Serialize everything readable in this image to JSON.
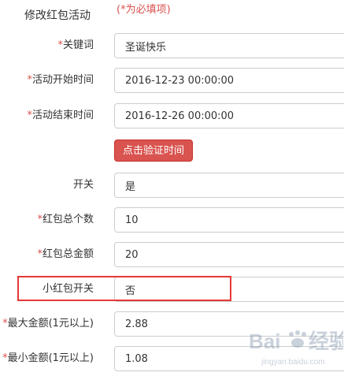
{
  "header": {
    "title": "修改红包活动",
    "required_note": "(*为必填项)"
  },
  "form": {
    "fields": [
      {
        "marker": "*",
        "label": "关键词",
        "value": "圣诞快乐"
      },
      {
        "marker": "*",
        "label": "活动开始时间",
        "value": "2016-12-23 00:00:00"
      },
      {
        "marker": "*",
        "label": "活动结束时间",
        "value": "2016-12-26 00:00:00"
      },
      {
        "marker": "",
        "label": "开关",
        "value": "是"
      },
      {
        "marker": "*",
        "label": "红包总个数",
        "value": "10"
      },
      {
        "marker": "*",
        "label": "红包总金额",
        "value": "20"
      },
      {
        "marker": "",
        "label": "小红包开关",
        "value": "否"
      },
      {
        "marker": "*",
        "label": "最大金额(1元以上)",
        "value": "2.88"
      },
      {
        "marker": "*",
        "label": "最小金额(1元以上)",
        "value": "1.08"
      }
    ],
    "verify_button_label": "点击验证时间"
  },
  "annotation": {
    "highlighted_field": "小红包开关",
    "color": "#e53935"
  },
  "watermark": {
    "brand": "Baidu",
    "sub": "jingyan.baidu.com"
  },
  "colors": {
    "required": "#d9534f",
    "button_bg": "#d9534f",
    "border": "#cccccc"
  }
}
